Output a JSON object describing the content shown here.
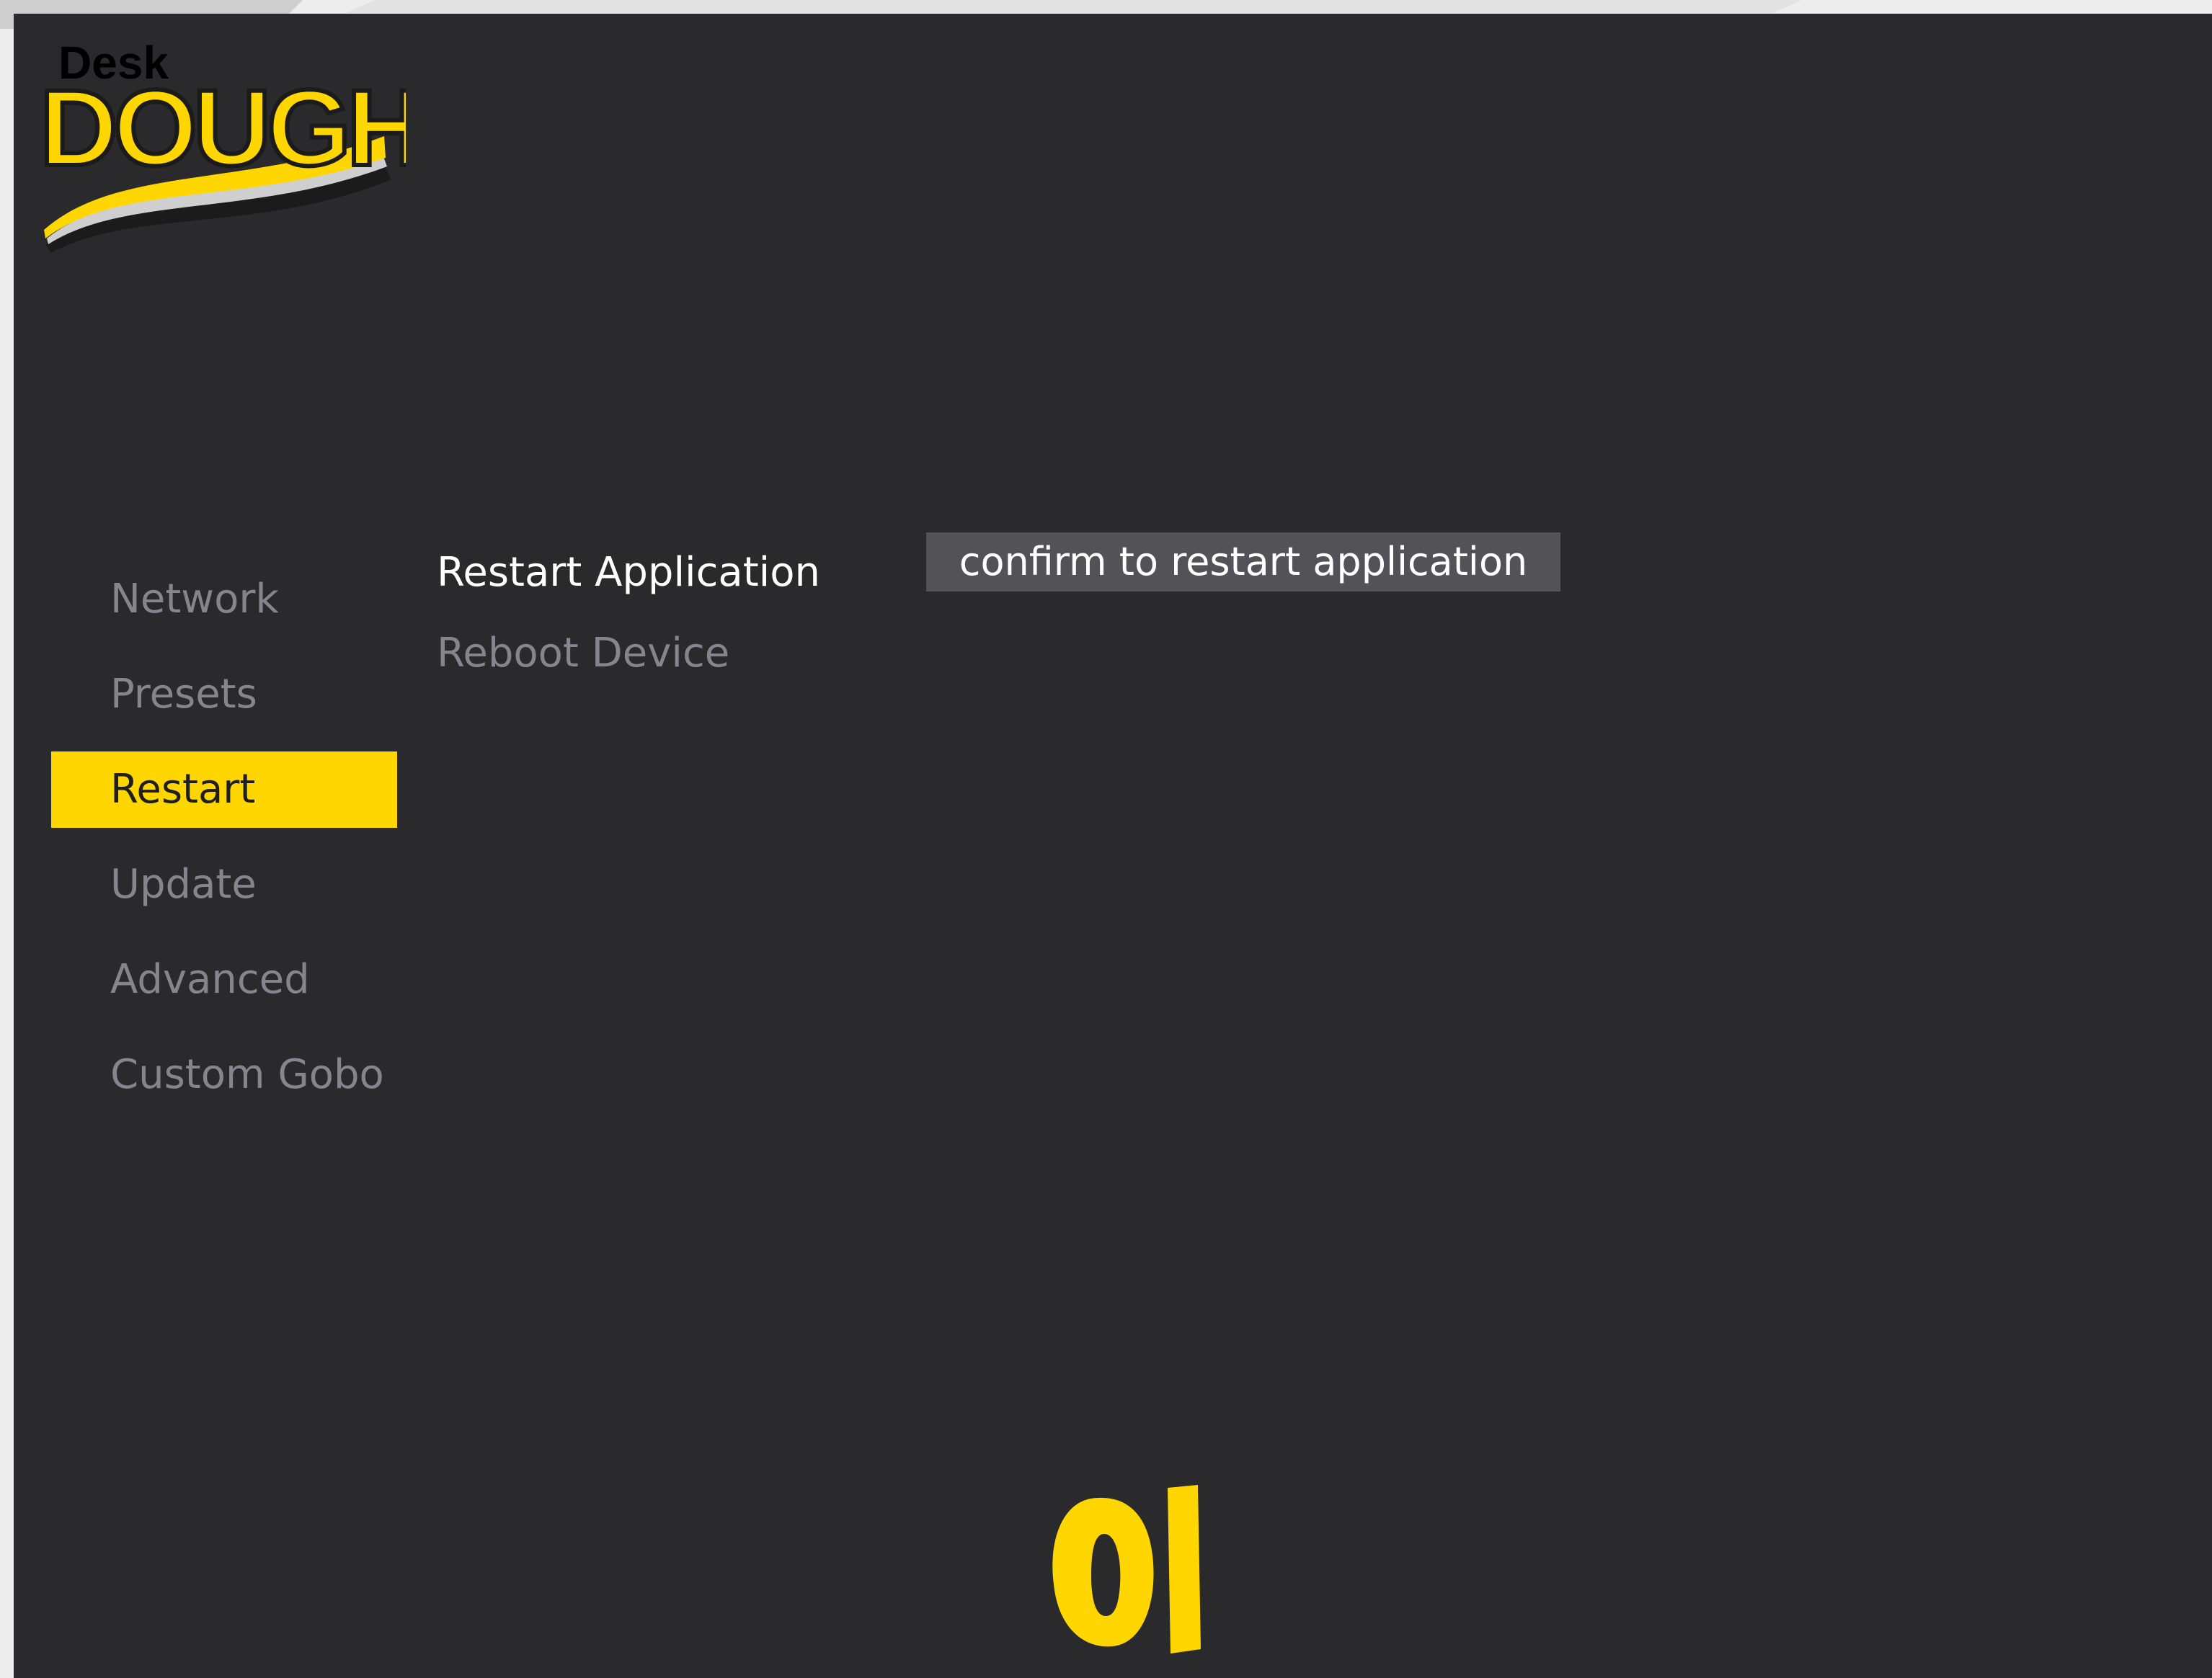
{
  "logo": {
    "small_text": "Desk",
    "main_text": "DOUGH"
  },
  "colors": {
    "background": "#2a292c",
    "accent": "#ffd600",
    "inactive_text": "#86858b",
    "active_text": "#ffffff",
    "button_bg": "#535257"
  },
  "sidebar": {
    "items": [
      {
        "label": "Network"
      },
      {
        "label": "Presets"
      },
      {
        "label": "Restart"
      },
      {
        "label": "Update"
      },
      {
        "label": "Advanced"
      },
      {
        "label": "Custom Gobo"
      }
    ],
    "active": "Restart"
  },
  "restart_panel": {
    "options": [
      {
        "label": "Restart Application"
      },
      {
        "label": "Reboot Device"
      }
    ],
    "selected": "Restart Application",
    "confirm_label": "confirm to restart application"
  },
  "footer": {
    "brand_mark_icon": "ol-brand-mark-icon"
  }
}
